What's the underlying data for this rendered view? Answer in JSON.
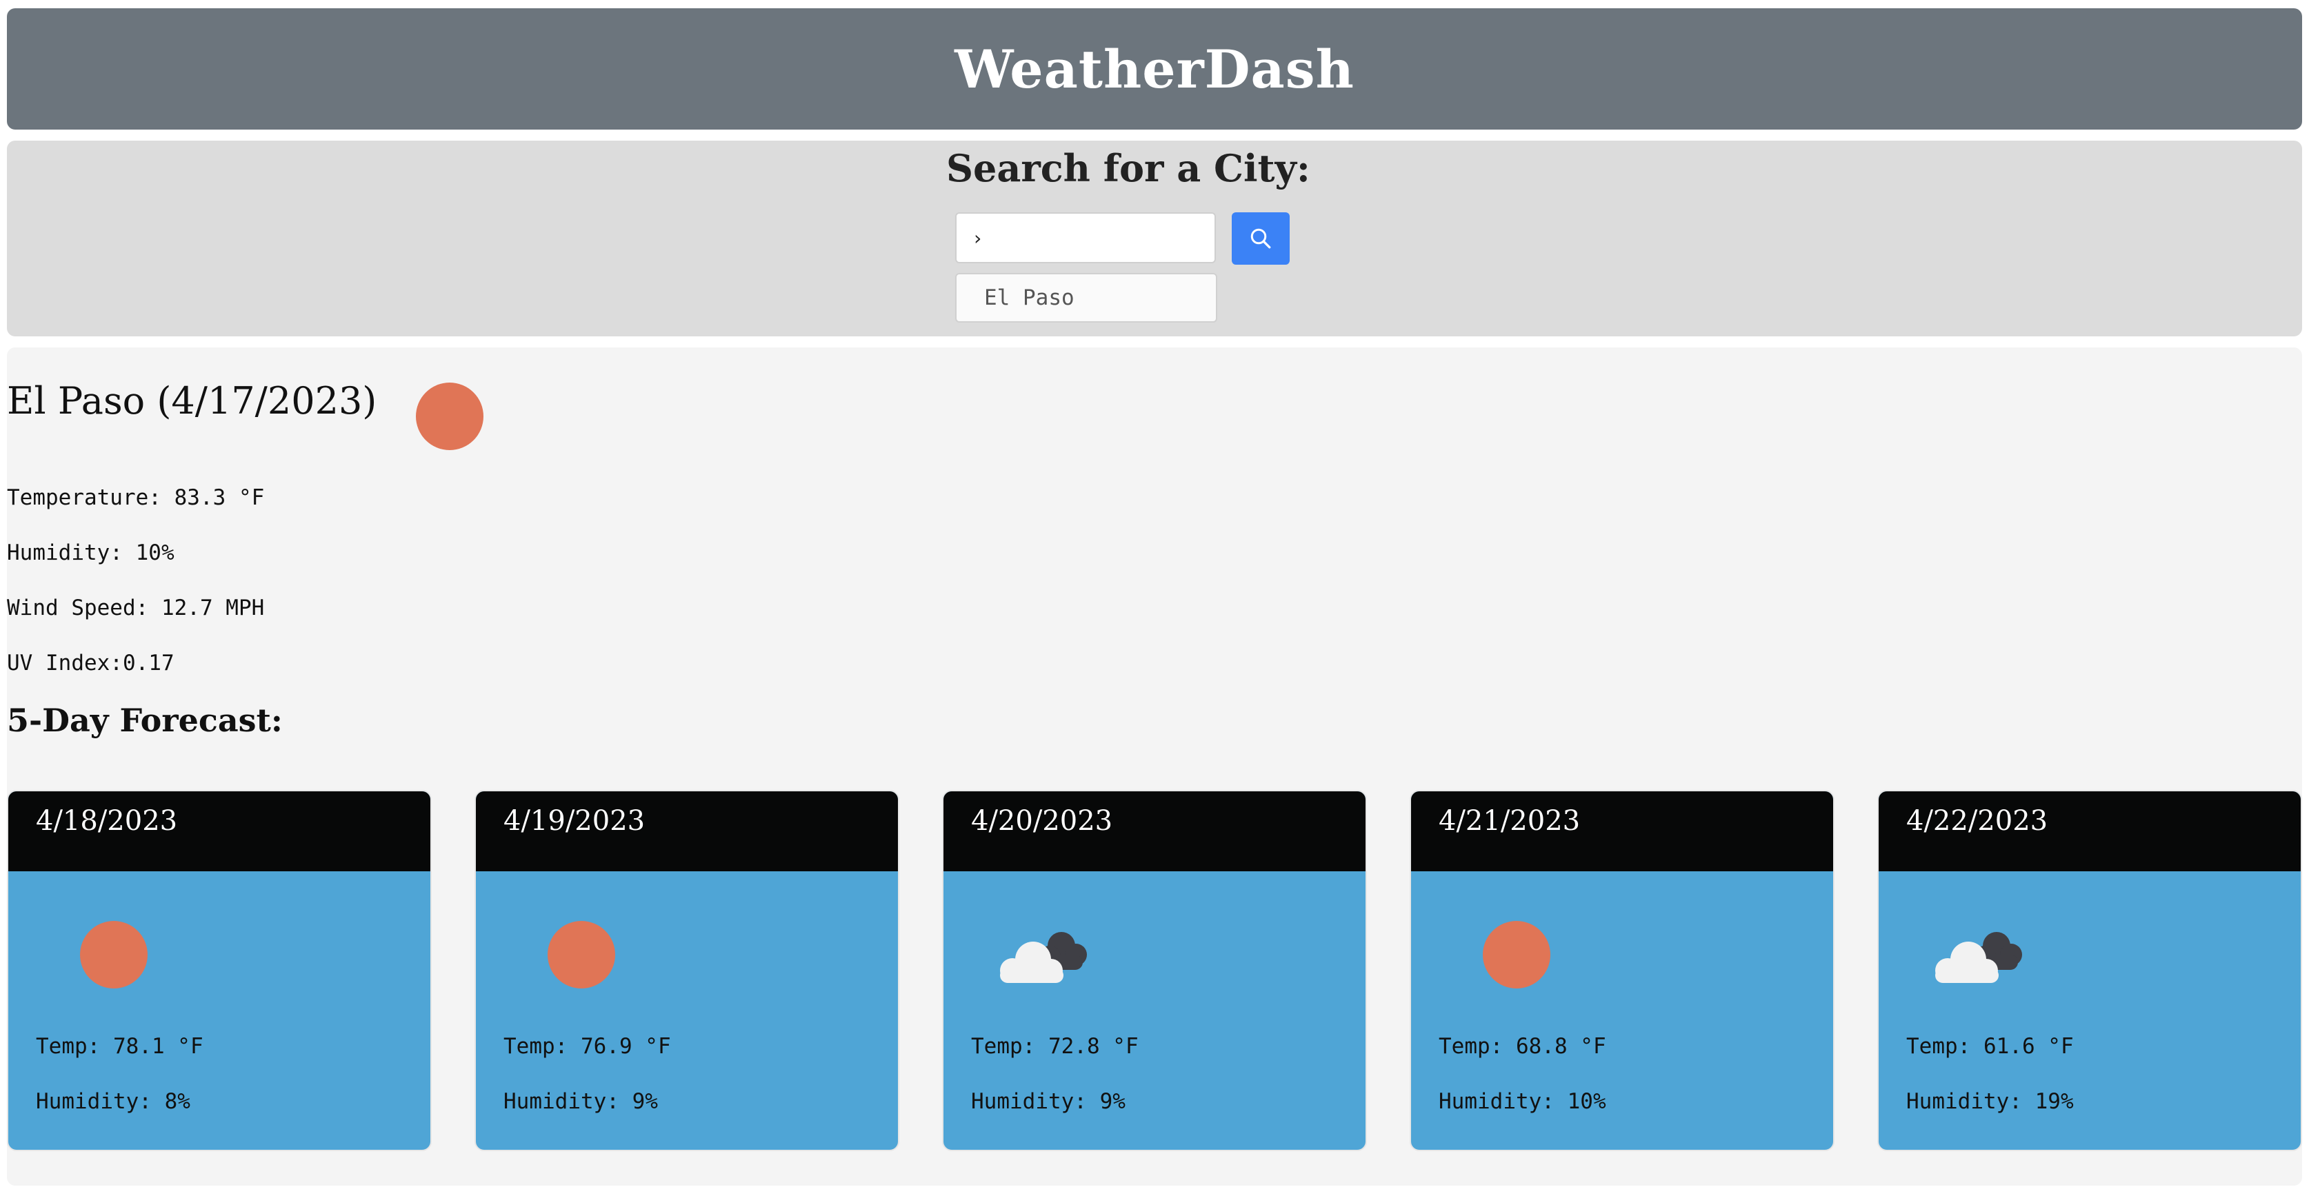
{
  "header": {
    "title": "WeatherDash"
  },
  "search": {
    "title": "Search for a City:",
    "input_value": "›",
    "history": [
      "El Paso"
    ],
    "button_icon": "search-icon"
  },
  "current": {
    "heading": "El Paso (4/17/2023)",
    "icon": "sun-icon",
    "temperature": "Temperature: 83.3 °F",
    "humidity": "Humidity: 10%",
    "wind": "Wind Speed: 12.7 MPH",
    "uv": "UV Index:0.17"
  },
  "forecast": {
    "heading": "5-Day Forecast:",
    "days": [
      {
        "date": "4/18/2023",
        "icon": "sun-icon",
        "temp": "Temp: 78.1 °F",
        "humidity": "Humidity: 8%"
      },
      {
        "date": "4/19/2023",
        "icon": "sun-icon",
        "temp": "Temp: 76.9 °F",
        "humidity": "Humidity: 9%"
      },
      {
        "date": "4/20/2023",
        "icon": "cloud-icon",
        "temp": "Temp: 72.8 °F",
        "humidity": "Humidity: 9%"
      },
      {
        "date": "4/21/2023",
        "icon": "sun-icon",
        "temp": "Temp: 68.8 °F",
        "humidity": "Humidity: 10%"
      },
      {
        "date": "4/22/2023",
        "icon": "cloud-icon",
        "temp": "Temp: 61.6 °F",
        "humidity": "Humidity: 19%"
      }
    ]
  },
  "colors": {
    "header_bg": "#6c757d",
    "search_bg": "#dcdcdc",
    "main_bg": "#f4f4f4",
    "button_blue": "#3b82f6",
    "card_bg": "#4fa5d6",
    "card_header_bg": "#070808",
    "sun": "#e07556"
  }
}
